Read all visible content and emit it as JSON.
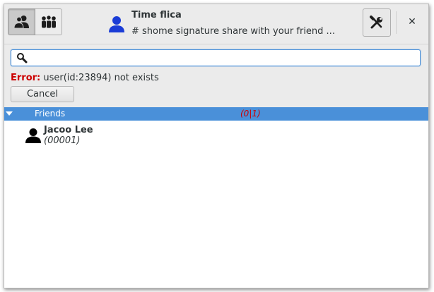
{
  "header": {
    "modes": [
      {
        "name": "contacts",
        "icon": "contacts-icon",
        "active": true
      },
      {
        "name": "groups",
        "icon": "group-icon",
        "active": false
      }
    ],
    "self": {
      "name": "Time flica",
      "status": "# shome signature share with your friend ..."
    },
    "tools_icon": "tools-icon",
    "close_glyph": "✕"
  },
  "search": {
    "value": "",
    "placeholder": "",
    "icon": "search-icon"
  },
  "error": {
    "label": "Error:",
    "message": " user(id:23894) not exists"
  },
  "cancel_label": "Cancel",
  "group": {
    "name": "Friends",
    "count": "(0|1)"
  },
  "contacts": [
    {
      "name": "Jacoo Lee",
      "id": "(00001)"
    }
  ],
  "colors": {
    "selection": "#4a90d9",
    "error": "#cc0000",
    "self_avatar": "#1a3cd6"
  }
}
